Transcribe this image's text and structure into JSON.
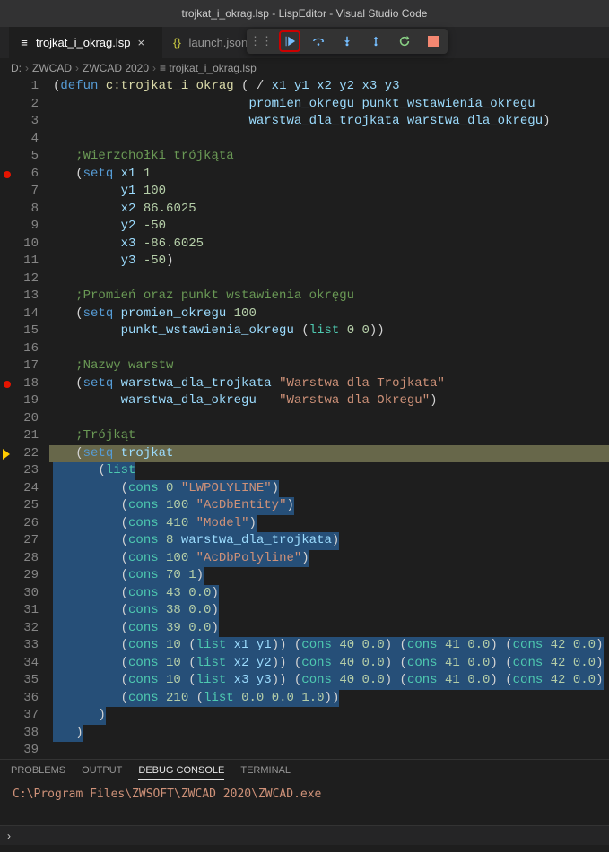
{
  "titlebar": "trojkat_i_okrag.lsp - LispEditor - Visual Studio Code",
  "tabs": [
    {
      "label": "trojkat_i_okrag.lsp",
      "active": true,
      "icon": "file-lisp"
    },
    {
      "label": "launch.json",
      "active": false,
      "icon": "json"
    }
  ],
  "debugToolbar": {
    "buttons": [
      "grip",
      "continue",
      "step-over",
      "step-into",
      "step-out",
      "restart",
      "stop"
    ]
  },
  "breadcrumb": [
    "D:",
    "ZWCAD",
    "ZWCAD 2020",
    "trojkat_i_okrag.lsp"
  ],
  "code": {
    "lines": [
      {
        "n": 1,
        "tokens": [
          [
            "punc",
            "("
          ],
          [
            "kw-blue",
            "defun"
          ],
          [
            "punc",
            " "
          ],
          [
            "fn-yellow",
            "c:trojkat_i_okrag"
          ],
          [
            "punc",
            " ( / "
          ],
          [
            "var",
            "x1 y1 x2 y2 x3 y3"
          ]
        ]
      },
      {
        "n": 2,
        "tokens": [
          [
            "punc",
            "                          "
          ],
          [
            "var",
            "promien_okregu punkt_wstawienia_okregu"
          ]
        ]
      },
      {
        "n": 3,
        "tokens": [
          [
            "punc",
            "                          "
          ],
          [
            "var",
            "warstwa_dla_trojkata warstwa_dla_okregu"
          ],
          [
            "punc",
            ")"
          ]
        ]
      },
      {
        "n": 4,
        "tokens": []
      },
      {
        "n": 5,
        "tokens": [
          [
            "punc",
            "   "
          ],
          [
            "comment",
            ";Wierzchołki trójkąta"
          ]
        ]
      },
      {
        "n": 6,
        "tokens": [
          [
            "punc",
            "   ("
          ],
          [
            "kw-blue",
            "setq"
          ],
          [
            "punc",
            " "
          ],
          [
            "var",
            "x1"
          ],
          [
            "punc",
            " "
          ],
          [
            "num",
            "1"
          ]
        ],
        "bp": true
      },
      {
        "n": 7,
        "tokens": [
          [
            "punc",
            "         "
          ],
          [
            "var",
            "y1"
          ],
          [
            "punc",
            " "
          ],
          [
            "num",
            "100"
          ]
        ]
      },
      {
        "n": 8,
        "tokens": [
          [
            "punc",
            "         "
          ],
          [
            "var",
            "x2"
          ],
          [
            "punc",
            " "
          ],
          [
            "num",
            "86.6025"
          ]
        ]
      },
      {
        "n": 9,
        "tokens": [
          [
            "punc",
            "         "
          ],
          [
            "var",
            "y2"
          ],
          [
            "punc",
            " "
          ],
          [
            "num",
            "-50"
          ]
        ]
      },
      {
        "n": 10,
        "tokens": [
          [
            "punc",
            "         "
          ],
          [
            "var",
            "x3"
          ],
          [
            "punc",
            " "
          ],
          [
            "num",
            "-86.6025"
          ]
        ]
      },
      {
        "n": 11,
        "tokens": [
          [
            "punc",
            "         "
          ],
          [
            "var",
            "y3"
          ],
          [
            "punc",
            " "
          ],
          [
            "num",
            "-50"
          ],
          [
            "punc",
            ")"
          ]
        ]
      },
      {
        "n": 12,
        "tokens": []
      },
      {
        "n": 13,
        "tokens": [
          [
            "punc",
            "   "
          ],
          [
            "comment",
            ";Promień oraz punkt wstawienia okręgu"
          ]
        ]
      },
      {
        "n": 14,
        "tokens": [
          [
            "punc",
            "   ("
          ],
          [
            "kw-blue",
            "setq"
          ],
          [
            "punc",
            " "
          ],
          [
            "var",
            "promien_okregu"
          ],
          [
            "punc",
            " "
          ],
          [
            "num",
            "100"
          ]
        ]
      },
      {
        "n": 15,
        "tokens": [
          [
            "punc",
            "         "
          ],
          [
            "var",
            "punkt_wstawienia_okregu"
          ],
          [
            "punc",
            " ("
          ],
          [
            "kw-teal",
            "list"
          ],
          [
            "punc",
            " "
          ],
          [
            "num",
            "0"
          ],
          [
            "punc",
            " "
          ],
          [
            "num",
            "0"
          ],
          [
            "punc",
            "))"
          ]
        ]
      },
      {
        "n": 16,
        "tokens": []
      },
      {
        "n": 17,
        "tokens": [
          [
            "punc",
            "   "
          ],
          [
            "comment",
            ";Nazwy warstw"
          ]
        ]
      },
      {
        "n": 18,
        "tokens": [
          [
            "punc",
            "   ("
          ],
          [
            "kw-blue",
            "setq"
          ],
          [
            "punc",
            " "
          ],
          [
            "var",
            "warstwa_dla_trojkata"
          ],
          [
            "punc",
            " "
          ],
          [
            "str",
            "\"Warstwa dla Trojkata\""
          ]
        ],
        "bp": true
      },
      {
        "n": 19,
        "tokens": [
          [
            "punc",
            "         "
          ],
          [
            "var",
            "warstwa_dla_okregu"
          ],
          [
            "punc",
            "   "
          ],
          [
            "str",
            "\"Warstwa dla Okregu\""
          ],
          [
            "punc",
            ")"
          ]
        ]
      },
      {
        "n": 20,
        "tokens": []
      },
      {
        "n": 21,
        "tokens": [
          [
            "punc",
            "   "
          ],
          [
            "comment",
            ";Trójkąt"
          ]
        ]
      },
      {
        "n": 22,
        "tokens": [
          [
            "punc",
            "   ("
          ],
          [
            "kw-blue",
            "setq"
          ],
          [
            "punc",
            " "
          ],
          [
            "var",
            "trojkat"
          ]
        ],
        "current": true,
        "sel": true
      },
      {
        "n": 23,
        "tokens": [
          [
            "punc",
            "      ("
          ],
          [
            "kw-teal",
            "list"
          ]
        ],
        "sel": true
      },
      {
        "n": 24,
        "tokens": [
          [
            "punc",
            "         ("
          ],
          [
            "kw-teal",
            "cons"
          ],
          [
            "punc",
            " "
          ],
          [
            "num",
            "0"
          ],
          [
            "punc",
            " "
          ],
          [
            "str",
            "\"LWPOLYLINE\""
          ],
          [
            "punc",
            ")"
          ]
        ],
        "sel": true
      },
      {
        "n": 25,
        "tokens": [
          [
            "punc",
            "         ("
          ],
          [
            "kw-teal",
            "cons"
          ],
          [
            "punc",
            " "
          ],
          [
            "num",
            "100"
          ],
          [
            "punc",
            " "
          ],
          [
            "str",
            "\"AcDbEntity\""
          ],
          [
            "punc",
            ")"
          ]
        ],
        "sel": true
      },
      {
        "n": 26,
        "tokens": [
          [
            "punc",
            "         ("
          ],
          [
            "kw-teal",
            "cons"
          ],
          [
            "punc",
            " "
          ],
          [
            "num",
            "410"
          ],
          [
            "punc",
            " "
          ],
          [
            "str",
            "\"Model\""
          ],
          [
            "punc",
            ")"
          ]
        ],
        "sel": true
      },
      {
        "n": 27,
        "tokens": [
          [
            "punc",
            "         ("
          ],
          [
            "kw-teal",
            "cons"
          ],
          [
            "punc",
            " "
          ],
          [
            "num",
            "8"
          ],
          [
            "punc",
            " "
          ],
          [
            "var",
            "warstwa_dla_trojkata"
          ],
          [
            "punc",
            ")"
          ]
        ],
        "sel": true
      },
      {
        "n": 28,
        "tokens": [
          [
            "punc",
            "         ("
          ],
          [
            "kw-teal",
            "cons"
          ],
          [
            "punc",
            " "
          ],
          [
            "num",
            "100"
          ],
          [
            "punc",
            " "
          ],
          [
            "str",
            "\"AcDbPolyline\""
          ],
          [
            "punc",
            ")"
          ]
        ],
        "sel": true
      },
      {
        "n": 29,
        "tokens": [
          [
            "punc",
            "         ("
          ],
          [
            "kw-teal",
            "cons"
          ],
          [
            "punc",
            " "
          ],
          [
            "num",
            "70"
          ],
          [
            "punc",
            " "
          ],
          [
            "num",
            "1"
          ],
          [
            "punc",
            ")"
          ]
        ],
        "sel": true
      },
      {
        "n": 30,
        "tokens": [
          [
            "punc",
            "         ("
          ],
          [
            "kw-teal",
            "cons"
          ],
          [
            "punc",
            " "
          ],
          [
            "num",
            "43"
          ],
          [
            "punc",
            " "
          ],
          [
            "num",
            "0.0"
          ],
          [
            "punc",
            ")"
          ]
        ],
        "sel": true
      },
      {
        "n": 31,
        "tokens": [
          [
            "punc",
            "         ("
          ],
          [
            "kw-teal",
            "cons"
          ],
          [
            "punc",
            " "
          ],
          [
            "num",
            "38"
          ],
          [
            "punc",
            " "
          ],
          [
            "num",
            "0.0"
          ],
          [
            "punc",
            ")"
          ]
        ],
        "sel": true
      },
      {
        "n": 32,
        "tokens": [
          [
            "punc",
            "         ("
          ],
          [
            "kw-teal",
            "cons"
          ],
          [
            "punc",
            " "
          ],
          [
            "num",
            "39"
          ],
          [
            "punc",
            " "
          ],
          [
            "num",
            "0.0"
          ],
          [
            "punc",
            ")"
          ]
        ],
        "sel": true
      },
      {
        "n": 33,
        "tokens": [
          [
            "punc",
            "         ("
          ],
          [
            "kw-teal",
            "cons"
          ],
          [
            "punc",
            " "
          ],
          [
            "num",
            "10"
          ],
          [
            "punc",
            " ("
          ],
          [
            "kw-teal",
            "list"
          ],
          [
            "punc",
            " "
          ],
          [
            "var",
            "x1 y1"
          ],
          [
            "punc",
            ")) ("
          ],
          [
            "kw-teal",
            "cons"
          ],
          [
            "punc",
            " "
          ],
          [
            "num",
            "40"
          ],
          [
            "punc",
            " "
          ],
          [
            "num",
            "0.0"
          ],
          [
            "punc",
            ") ("
          ],
          [
            "kw-teal",
            "cons"
          ],
          [
            "punc",
            " "
          ],
          [
            "num",
            "41"
          ],
          [
            "punc",
            " "
          ],
          [
            "num",
            "0.0"
          ],
          [
            "punc",
            ") ("
          ],
          [
            "kw-teal",
            "cons"
          ],
          [
            "punc",
            " "
          ],
          [
            "num",
            "42"
          ],
          [
            "punc",
            " "
          ],
          [
            "num",
            "0.0"
          ],
          [
            "punc",
            ")"
          ]
        ],
        "sel": true
      },
      {
        "n": 34,
        "tokens": [
          [
            "punc",
            "         ("
          ],
          [
            "kw-teal",
            "cons"
          ],
          [
            "punc",
            " "
          ],
          [
            "num",
            "10"
          ],
          [
            "punc",
            " ("
          ],
          [
            "kw-teal",
            "list"
          ],
          [
            "punc",
            " "
          ],
          [
            "var",
            "x2 y2"
          ],
          [
            "punc",
            ")) ("
          ],
          [
            "kw-teal",
            "cons"
          ],
          [
            "punc",
            " "
          ],
          [
            "num",
            "40"
          ],
          [
            "punc",
            " "
          ],
          [
            "num",
            "0.0"
          ],
          [
            "punc",
            ") ("
          ],
          [
            "kw-teal",
            "cons"
          ],
          [
            "punc",
            " "
          ],
          [
            "num",
            "41"
          ],
          [
            "punc",
            " "
          ],
          [
            "num",
            "0.0"
          ],
          [
            "punc",
            ") ("
          ],
          [
            "kw-teal",
            "cons"
          ],
          [
            "punc",
            " "
          ],
          [
            "num",
            "42"
          ],
          [
            "punc",
            " "
          ],
          [
            "num",
            "0.0"
          ],
          [
            "punc",
            ")"
          ]
        ],
        "sel": true
      },
      {
        "n": 35,
        "tokens": [
          [
            "punc",
            "         ("
          ],
          [
            "kw-teal",
            "cons"
          ],
          [
            "punc",
            " "
          ],
          [
            "num",
            "10"
          ],
          [
            "punc",
            " ("
          ],
          [
            "kw-teal",
            "list"
          ],
          [
            "punc",
            " "
          ],
          [
            "var",
            "x3 y3"
          ],
          [
            "punc",
            ")) ("
          ],
          [
            "kw-teal",
            "cons"
          ],
          [
            "punc",
            " "
          ],
          [
            "num",
            "40"
          ],
          [
            "punc",
            " "
          ],
          [
            "num",
            "0.0"
          ],
          [
            "punc",
            ") ("
          ],
          [
            "kw-teal",
            "cons"
          ],
          [
            "punc",
            " "
          ],
          [
            "num",
            "41"
          ],
          [
            "punc",
            " "
          ],
          [
            "num",
            "0.0"
          ],
          [
            "punc",
            ") ("
          ],
          [
            "kw-teal",
            "cons"
          ],
          [
            "punc",
            " "
          ],
          [
            "num",
            "42"
          ],
          [
            "punc",
            " "
          ],
          [
            "num",
            "0.0"
          ],
          [
            "punc",
            ")"
          ]
        ],
        "sel": true
      },
      {
        "n": 36,
        "tokens": [
          [
            "punc",
            "         ("
          ],
          [
            "kw-teal",
            "cons"
          ],
          [
            "punc",
            " "
          ],
          [
            "num",
            "210"
          ],
          [
            "punc",
            " ("
          ],
          [
            "kw-teal",
            "list"
          ],
          [
            "punc",
            " "
          ],
          [
            "num",
            "0.0"
          ],
          [
            "punc",
            " "
          ],
          [
            "num",
            "0.0"
          ],
          [
            "punc",
            " "
          ],
          [
            "num",
            "1.0"
          ],
          [
            "punc",
            "))"
          ]
        ],
        "sel": true
      },
      {
        "n": 37,
        "tokens": [
          [
            "punc",
            "      )"
          ]
        ],
        "sel": true
      },
      {
        "n": 38,
        "tokens": [
          [
            "punc",
            "   )"
          ]
        ],
        "sel": true
      },
      {
        "n": 39,
        "tokens": []
      }
    ]
  },
  "panelTabs": [
    "PROBLEMS",
    "OUTPUT",
    "DEBUG CONSOLE",
    "TERMINAL"
  ],
  "panelActive": "DEBUG CONSOLE",
  "console": "C:\\Program Files\\ZWSOFT\\ZWCAD 2020\\ZWCAD.exe",
  "statusbar": {
    "input": "›"
  }
}
